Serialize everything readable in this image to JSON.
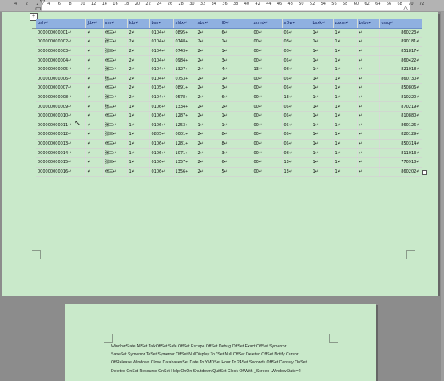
{
  "ruler": {
    "numbers": [
      "4",
      "2",
      "2",
      "4",
      "6",
      "8",
      "10",
      "12",
      "14",
      "16",
      "18",
      "20",
      "22",
      "24",
      "26",
      "28",
      "30",
      "32",
      "34",
      "36",
      "38",
      "40",
      "42",
      "44",
      "46",
      "48",
      "50",
      "52",
      "54",
      "56",
      "58",
      "60",
      "62",
      "64",
      "66",
      "68",
      "70",
      "72"
    ]
  },
  "table": {
    "headers": [
      "bsh",
      "Jdx",
      "xm",
      "Idp",
      "bsn",
      "xldx",
      "xbx",
      "ID",
      "zzmd",
      "xDw",
      "bsxk",
      "zzxm",
      "bsbe",
      "csrq"
    ],
    "rows": [
      [
        "000000000001",
        "",
        "张三",
        "2",
        "0104",
        "0895",
        "2",
        "6",
        "00",
        "05",
        "1",
        "1",
        "",
        "860223"
      ],
      [
        "000000000002",
        "",
        "张三",
        "2",
        "0104",
        "0748",
        "2",
        "1",
        "00",
        "08",
        "1",
        "1",
        "",
        "890181"
      ],
      [
        "000000000003",
        "",
        "张三",
        "2",
        "0104",
        "0743",
        "2",
        "1",
        "00",
        "08",
        "1",
        "1",
        "",
        "851817"
      ],
      [
        "000000000004",
        "",
        "张三",
        "2",
        "0104",
        "0984",
        "2",
        "3",
        "00",
        "05",
        "1",
        "1",
        "",
        "860422"
      ],
      [
        "000000000005",
        "",
        "张三",
        "2",
        "0104",
        "1327",
        "2",
        "4",
        "13",
        "08",
        "1",
        "1",
        "",
        "821018"
      ],
      [
        "000000000006",
        "",
        "张三",
        "2",
        "0104",
        "0753",
        "2",
        "1",
        "00",
        "05",
        "1",
        "1",
        "",
        "860730"
      ],
      [
        "000000000007",
        "",
        "张三",
        "2",
        "0105",
        "0891",
        "2",
        "3",
        "00",
        "05",
        "1",
        "1",
        "",
        "850806"
      ],
      [
        "000000000008",
        "",
        "张三",
        "2",
        "0104",
        "0578",
        "2",
        "6",
        "00",
        "13",
        "1",
        "1",
        "",
        "810220"
      ],
      [
        "000000000009",
        "",
        "张三",
        "1",
        "0106",
        "1334",
        "2",
        "2",
        "00",
        "05",
        "1",
        "1",
        "",
        "870219"
      ],
      [
        "000000000010",
        "",
        "张三",
        "1",
        "0106",
        "1287",
        "2",
        "1",
        "00",
        "05",
        "1",
        "1",
        "",
        "810880"
      ],
      [
        "000000000011",
        "",
        "张三",
        "1",
        "0106",
        "1253",
        "1",
        "1",
        "00",
        "05",
        "1",
        "1",
        "",
        "860126"
      ],
      [
        "000000000012",
        "",
        "张三",
        "1",
        "0805",
        "0001",
        "2",
        "8",
        "00",
        "05",
        "1",
        "1",
        "",
        "820129"
      ],
      [
        "000000000013",
        "",
        "张三",
        "1",
        "0106",
        "1281",
        "2",
        "8",
        "00",
        "05",
        "1",
        "1",
        "",
        "850314"
      ],
      [
        "000000000014",
        "",
        "张三",
        "1",
        "0106",
        "1071",
        "2",
        "3",
        "00",
        "08",
        "1",
        "1",
        "",
        "811013"
      ],
      [
        "000000000015",
        "",
        "张三",
        "1",
        "0106",
        "1357",
        "2",
        "6",
        "00",
        "13",
        "1",
        "1",
        "",
        "770918"
      ],
      [
        "000000000016",
        "",
        "张三",
        "1",
        "0106",
        "1356",
        "2",
        "5",
        "00",
        "13",
        "1",
        "1",
        "",
        "860202"
      ]
    ]
  },
  "page2": {
    "lines": [
      "WindowState AllSet TalkOffSet Safe OffSet Escape OffSet Debug OffSet Exact OffSet Symerror",
      "SaveSet Symerror ToSet Symerror OffSet NullDisplay To \"Set Null OffSet Deleted OffSet Notify Cursor",
      "OffRelease Windows Close DatabasesSet Date To YMDSet Hour To 24Set Seconds OffSet Century OnSet",
      "Deleted OnSet Resource OnSet Help OnOn Shutdown QuitSet Clock OffWith _Screen .WindowState=2"
    ]
  }
}
